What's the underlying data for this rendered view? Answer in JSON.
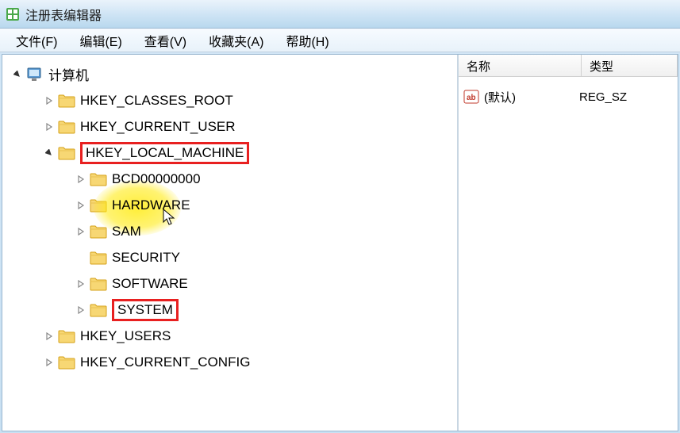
{
  "window": {
    "title": "注册表编辑器"
  },
  "menu": {
    "file": "文件(F)",
    "edit": "编辑(E)",
    "view": "查看(V)",
    "favorites": "收藏夹(A)",
    "help": "帮助(H)"
  },
  "tree": {
    "root": "计算机",
    "nodes": [
      {
        "label": "HKEY_CLASSES_ROOT",
        "expanded": false,
        "level": 1,
        "boxed": false
      },
      {
        "label": "HKEY_CURRENT_USER",
        "expanded": false,
        "level": 1,
        "boxed": false
      },
      {
        "label": "HKEY_LOCAL_MACHINE",
        "expanded": true,
        "level": 1,
        "boxed": true
      },
      {
        "label": "BCD00000000",
        "expanded": false,
        "level": 2,
        "boxed": false
      },
      {
        "label": "HARDWARE",
        "expanded": false,
        "level": 2,
        "boxed": false
      },
      {
        "label": "SAM",
        "expanded": false,
        "level": 2,
        "boxed": false
      },
      {
        "label": "SECURITY",
        "expanded": null,
        "level": 2,
        "boxed": false
      },
      {
        "label": "SOFTWARE",
        "expanded": false,
        "level": 2,
        "boxed": false
      },
      {
        "label": "SYSTEM",
        "expanded": false,
        "level": 2,
        "boxed": true
      },
      {
        "label": "HKEY_USERS",
        "expanded": false,
        "level": 1,
        "boxed": false
      },
      {
        "label": "HKEY_CURRENT_CONFIG",
        "expanded": false,
        "level": 1,
        "boxed": false
      }
    ]
  },
  "list": {
    "header": {
      "name": "名称",
      "type": "类型"
    },
    "rows": [
      {
        "name": "(默认)",
        "type": "REG_SZ"
      }
    ]
  }
}
